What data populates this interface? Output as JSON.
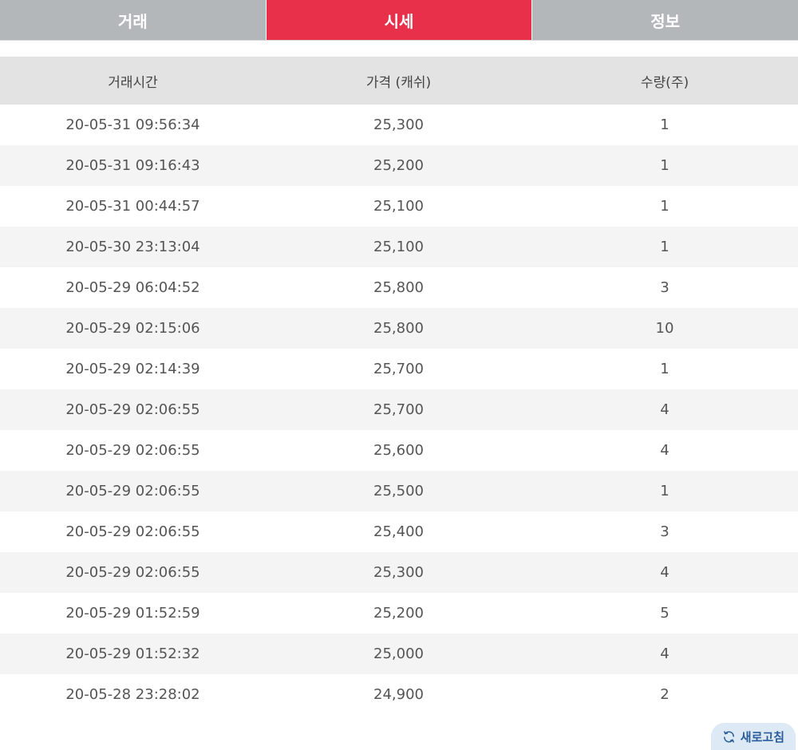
{
  "tabs": [
    {
      "label": "거래",
      "active": false
    },
    {
      "label": "시세",
      "active": true
    },
    {
      "label": "정보",
      "active": false
    }
  ],
  "table": {
    "headers": [
      "거래시간",
      "가격 (캐쉬)",
      "수량(주)"
    ],
    "rows": [
      [
        "20-05-31 09:56:34",
        "25,300",
        "1"
      ],
      [
        "20-05-31 09:16:43",
        "25,200",
        "1"
      ],
      [
        "20-05-31 00:44:57",
        "25,100",
        "1"
      ],
      [
        "20-05-30 23:13:04",
        "25,100",
        "1"
      ],
      [
        "20-05-29 06:04:52",
        "25,800",
        "3"
      ],
      [
        "20-05-29 02:15:06",
        "25,800",
        "10"
      ],
      [
        "20-05-29 02:14:39",
        "25,700",
        "1"
      ],
      [
        "20-05-29 02:06:55",
        "25,700",
        "4"
      ],
      [
        "20-05-29 02:06:55",
        "25,600",
        "4"
      ],
      [
        "20-05-29 02:06:55",
        "25,500",
        "1"
      ],
      [
        "20-05-29 02:06:55",
        "25,400",
        "3"
      ],
      [
        "20-05-29 02:06:55",
        "25,300",
        "4"
      ],
      [
        "20-05-29 01:52:59",
        "25,200",
        "5"
      ],
      [
        "20-05-29 01:52:32",
        "25,000",
        "4"
      ],
      [
        "20-05-28 23:28:02",
        "24,900",
        "2"
      ]
    ]
  },
  "refresh": {
    "label": "새로고침",
    "icon": "refresh-icon"
  },
  "colors": {
    "accent": "#e8304a",
    "tab_inactive": "#b4b7ba",
    "header_bg": "#e4e3e3",
    "refresh_bg": "#dde9f5",
    "refresh_text": "#2a5d9a"
  }
}
